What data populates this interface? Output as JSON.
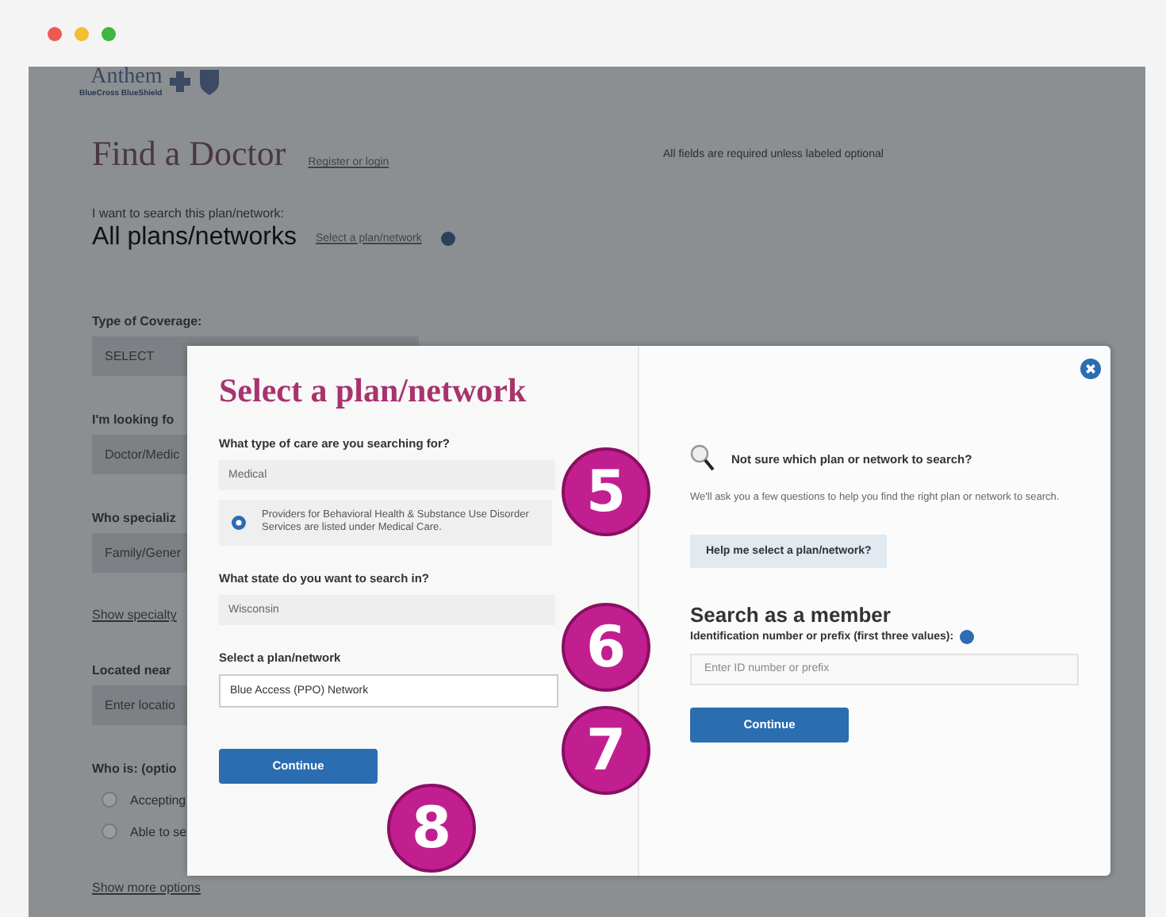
{
  "logo": {
    "name": "Anthem",
    "tagline": "BlueCross BlueShield"
  },
  "page": {
    "title": "Find a Doctor",
    "title_link": "Register or login",
    "required_note": "All fields are required unless labeled optional",
    "plan_label": "I want to search this plan/network:",
    "plan_value": "All plans/networks",
    "plan_link": "Select a plan/network",
    "form": [
      {
        "kind": "label",
        "text": "Type of Coverage:"
      },
      {
        "kind": "field",
        "text": "SELECT"
      },
      {
        "kind": "label",
        "text": "I'm looking fo"
      },
      {
        "kind": "field",
        "text": "Doctor/Medic"
      },
      {
        "kind": "label",
        "text": "Who specializ"
      },
      {
        "kind": "field",
        "text": "Family/Gener"
      },
      {
        "kind": "link",
        "text": "Show specialty"
      },
      {
        "kind": "label",
        "text": "Located near"
      },
      {
        "kind": "field",
        "text": "Enter locatio"
      },
      {
        "kind": "label",
        "text": "Who is: (optio"
      },
      {
        "kind": "radio",
        "text": "Accepting",
        "checked": false
      },
      {
        "kind": "radio",
        "text": "Able to se",
        "checked": false
      },
      {
        "kind": "link",
        "text": "Show more options"
      }
    ]
  },
  "modal": {
    "title": "Select a plan/network",
    "questions": [
      {
        "label": "What type of care are you searching for?",
        "value": "Medical",
        "info": "Providers for Behavioral Health & Substance Use Disorder Services are listed under Medical Care."
      },
      {
        "label": "What state do you want to search in?",
        "value": "Wisconsin"
      },
      {
        "label": "Select a plan/network",
        "value": "Blue Access (PPO) Network"
      }
    ],
    "continue": "Continue",
    "help_heading": "Not sure which plan or network to search?",
    "help_text": "We'll ask you a few questions to help you find the right plan or network to search.",
    "help_button": "Help me select a plan/network?",
    "member_heading": "Search as a member",
    "member_label": "Identification number or prefix (first three values):",
    "member_placeholder": "Enter ID number or prefix",
    "member_continue": "Continue"
  },
  "callouts": [
    "5",
    "6",
    "7",
    "8"
  ]
}
